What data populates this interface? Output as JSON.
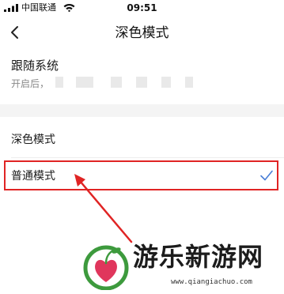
{
  "status_bar": {
    "carrier": "中国联通",
    "time": "09:51"
  },
  "nav": {
    "title": "深色模式",
    "back_icon": "chevron-left-icon"
  },
  "follow_system": {
    "title": "跟随系统",
    "description": "开启后，"
  },
  "options": [
    {
      "label": "深色模式",
      "selected": false
    },
    {
      "label": "普通模式",
      "selected": true
    }
  ],
  "accent_color": "#4a7fd6",
  "annotation_color": "#e02424",
  "watermark": {
    "text": "游乐新游网",
    "url": "www.qiangiachuo.com"
  }
}
